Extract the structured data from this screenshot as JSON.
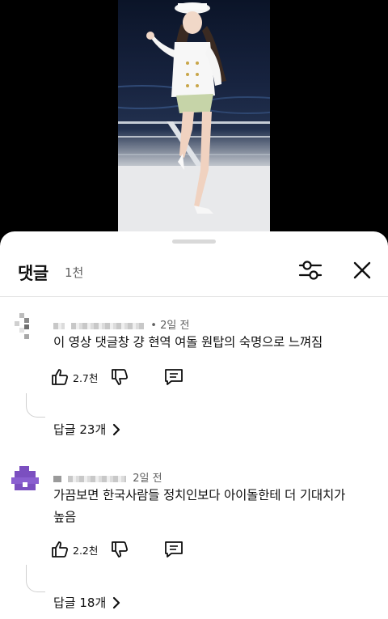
{
  "comments_panel": {
    "title": "댓글",
    "count": "1천"
  },
  "icons": {
    "filter": "sliders-icon",
    "close": "close-icon",
    "like": "thumbs-up-icon",
    "dislike": "thumbs-down-icon",
    "reply": "comment-icon",
    "replies_chevron": "chevron-right-icon"
  },
  "comments": [
    {
      "time": "2일 전",
      "separator": "•",
      "text": "이 영상 댓글창 걍 현역 여돌 원탑의 숙명으로 느껴짐",
      "likes": "2.7천",
      "replies": "답글 23개"
    },
    {
      "time": "2일 전",
      "text": "가끔보면 한국사람들 정치인보다 아이돌한테 더 기대치가 높음",
      "likes": "2.2천",
      "replies": "답글 18개",
      "avatar_color": "#7b4fc0"
    }
  ]
}
